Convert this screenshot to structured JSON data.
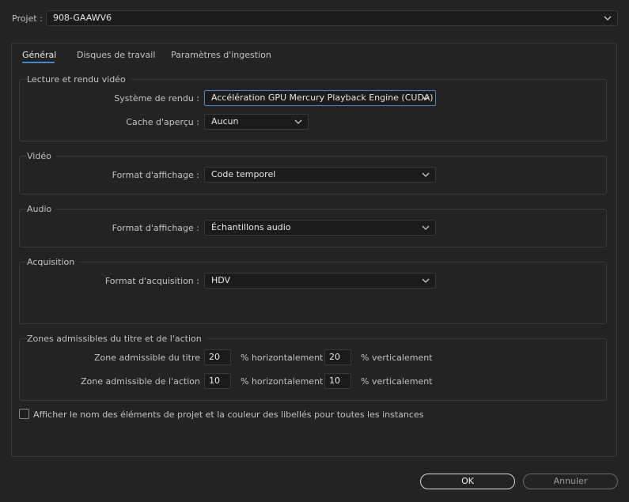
{
  "project": {
    "label": "Projet :",
    "value": "908-GAAWV6"
  },
  "tabs": [
    {
      "label": "Général"
    },
    {
      "label": "Disques de travail"
    },
    {
      "label": "Paramètres d'ingestion"
    }
  ],
  "lecture": {
    "title": "Lecture et rendu vidéo",
    "render_label": "Système de rendu :",
    "render_value": "Accélération GPU Mercury Playback Engine (CUDA)",
    "cache_label": "Cache d'aperçu :",
    "cache_value": "Aucun"
  },
  "video": {
    "title": "Vidéo",
    "format_label": "Format d'affichage :",
    "format_value": "Code temporel"
  },
  "audio": {
    "title": "Audio",
    "format_label": "Format d'affichage :",
    "format_value": "Échantillons audio"
  },
  "acquisition": {
    "title": "Acquisition",
    "format_label": "Format d'acquisition :",
    "format_value": "HDV"
  },
  "safe_zones": {
    "title": "Zones admissibles du titre et de l'action",
    "title_label": "Zone admissible du titre",
    "title_h": "20",
    "title_v": "20",
    "action_label": "Zone admissible de l'action",
    "action_h": "10",
    "action_v": "10",
    "h_unit": "% horizontalement",
    "v_unit": "% verticalement"
  },
  "checkbox": {
    "label": "Afficher le nom des éléments de projet et la couleur des libellés pour toutes les instances",
    "checked": false
  },
  "buttons": {
    "ok": "OK",
    "cancel": "Annuler"
  },
  "colors": {
    "accent": "#4a86c7",
    "background": "#232323"
  }
}
